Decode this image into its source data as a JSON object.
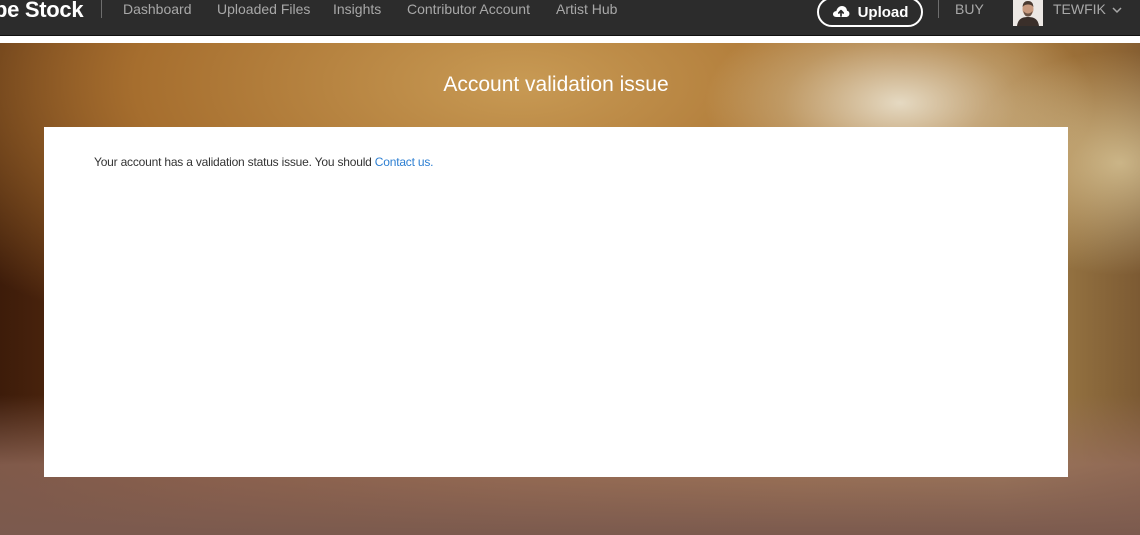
{
  "topbar": {
    "brand": "be Stock",
    "nav": [
      "Dashboard",
      "Uploaded Files",
      "Insights",
      "Contributor Account",
      "Artist Hub"
    ],
    "upload_label": "Upload",
    "buy_label": "BUY",
    "username": "TEWFIK"
  },
  "page": {
    "title": "Account validation issue",
    "message_text": "Your account has a validation status issue. You should",
    "contact_link": "Contact us."
  },
  "colors": {
    "topbar": "#2c2c2c",
    "link": "#2d7fd2"
  },
  "icons": {
    "upload": "cloud-upload-icon",
    "user_menu": "chevron-down-icon"
  }
}
